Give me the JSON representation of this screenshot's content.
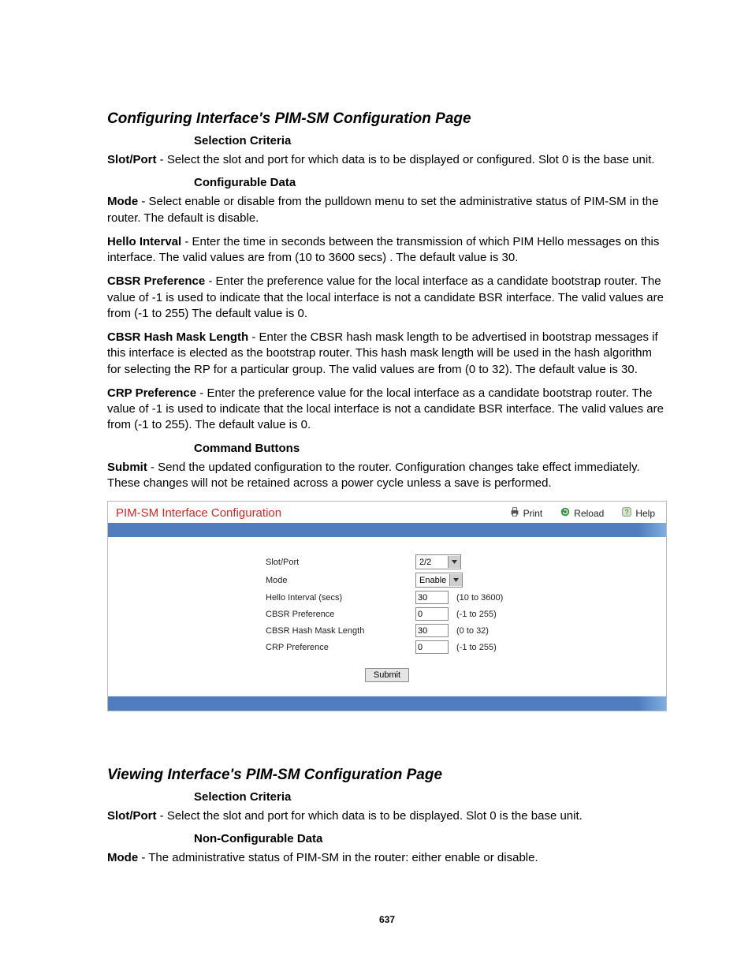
{
  "section1": {
    "title": "Configuring Interface's PIM-SM Configuration Page",
    "sub1": "Selection Criteria",
    "p1_term": "Slot/Port",
    "p1_text": " - Select the slot and port for which data is to be displayed or configured. Slot 0 is the base unit.",
    "sub2": "Configurable Data",
    "p2_term": "Mode",
    "p2_text": " - Select enable or disable from the pulldown menu to set the administrative status of PIM-SM in the router. The default is disable.",
    "p3_term": "Hello Interval",
    "p3_text": " - Enter the time in seconds between the transmission of which PIM Hello messages on this interface. The valid values are from (10 to 3600 secs) . The default value is 30.",
    "p4_term": "CBSR Preference",
    "p4_text": " - Enter the preference value for the local interface as a candidate bootstrap router. The value of -1 is used to indicate that the local interface is not a candidate BSR interface. The valid values are from (-1 to 255) The default value is 0.",
    "p5_term": "CBSR Hash Mask Length",
    "p5_text": " - Enter the CBSR hash mask length to be advertised in bootstrap messages if this interface is elected as the bootstrap router. This hash mask length will be used in the hash algorithm for selecting the RP for a particular group. The valid values are from (0 to 32). The default value is 30.",
    "p6_term": "CRP Preference",
    "p6_text": " - Enter the preference value for the local interface as a candidate bootstrap router. The value of -1 is used to indicate that the local interface is not a candidate BSR interface. The valid values are from (-1 to 255). The default value is 0.",
    "sub3": "Command Buttons",
    "p7_term": "Submit",
    "p7_text": " - Send the updated configuration to the router. Configuration changes take effect immediately. These changes will not be retained across a power cycle unless a save is performed."
  },
  "panel": {
    "title": "PIM-SM Interface Configuration",
    "actions": {
      "print": "Print",
      "reload": "Reload",
      "help": "Help"
    },
    "rows": {
      "slot_label": "Slot/Port",
      "slot_value": "2/2",
      "mode_label": "Mode",
      "mode_value": "Enable",
      "hello_label": "Hello Interval (secs)",
      "hello_value": "30",
      "hello_hint": "(10 to 3600)",
      "cbsrp_label": "CBSR Preference",
      "cbsrp_value": "0",
      "cbsrp_hint": "(-1 to 255)",
      "mask_label": "CBSR Hash Mask Length",
      "mask_value": "30",
      "mask_hint": "(0 to 32)",
      "crp_label": "CRP Preference",
      "crp_value": "0",
      "crp_hint": "(-1 to 255)"
    },
    "submit": "Submit"
  },
  "section2": {
    "title": "Viewing Interface's PIM-SM Configuration Page",
    "sub1": "Selection Criteria",
    "p1_term": "Slot/Port",
    "p1_text": " - Select the slot and port for which data is to be displayed. Slot 0 is the base unit.",
    "sub2": "Non-Configurable Data",
    "p2_term": "Mode",
    "p2_text": " - The administrative status of PIM-SM in the router: either enable or disable."
  },
  "page_number": "637"
}
